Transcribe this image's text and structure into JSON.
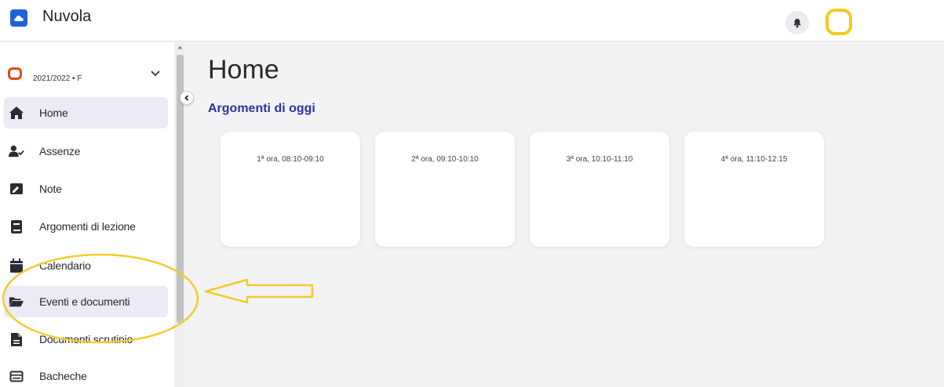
{
  "app": {
    "title": "Nuvola"
  },
  "colors": {
    "brand": "#1f64d6",
    "section_title": "#2a36a0",
    "active_nav_bg": "#ebeaf5",
    "annotation": "#f3cc2a",
    "avatar_border": "#f2cc1a",
    "year_icon": "#e04a12"
  },
  "sidebar": {
    "year_selector": "2021/2022 • F",
    "items": [
      {
        "label": "Home",
        "icon": "home-icon",
        "active": true
      },
      {
        "label": "Assenze",
        "icon": "user-check-icon",
        "active": false
      },
      {
        "label": "Note",
        "icon": "note-icon",
        "active": false
      },
      {
        "label": "Argomenti di lezione",
        "icon": "book-icon",
        "active": false
      },
      {
        "label": "Calendario",
        "icon": "calendar-icon",
        "active": false
      },
      {
        "label": "Eventi e documenti",
        "icon": "folder-open-icon",
        "active": false
      },
      {
        "label": "Documenti scrutinio",
        "icon": "document-icon",
        "active": false
      },
      {
        "label": "Bacheche",
        "icon": "board-icon",
        "active": false
      }
    ]
  },
  "main": {
    "title": "Home",
    "section_title": "Argomenti di oggi",
    "cards": [
      {
        "label": "1ª ora, 08:10-09:10"
      },
      {
        "label": "2ª ora, 09:10-10:10"
      },
      {
        "label": "3ª ora, 10:10-11:10"
      },
      {
        "label": "4ª ora, 11:10-12:15"
      }
    ]
  }
}
